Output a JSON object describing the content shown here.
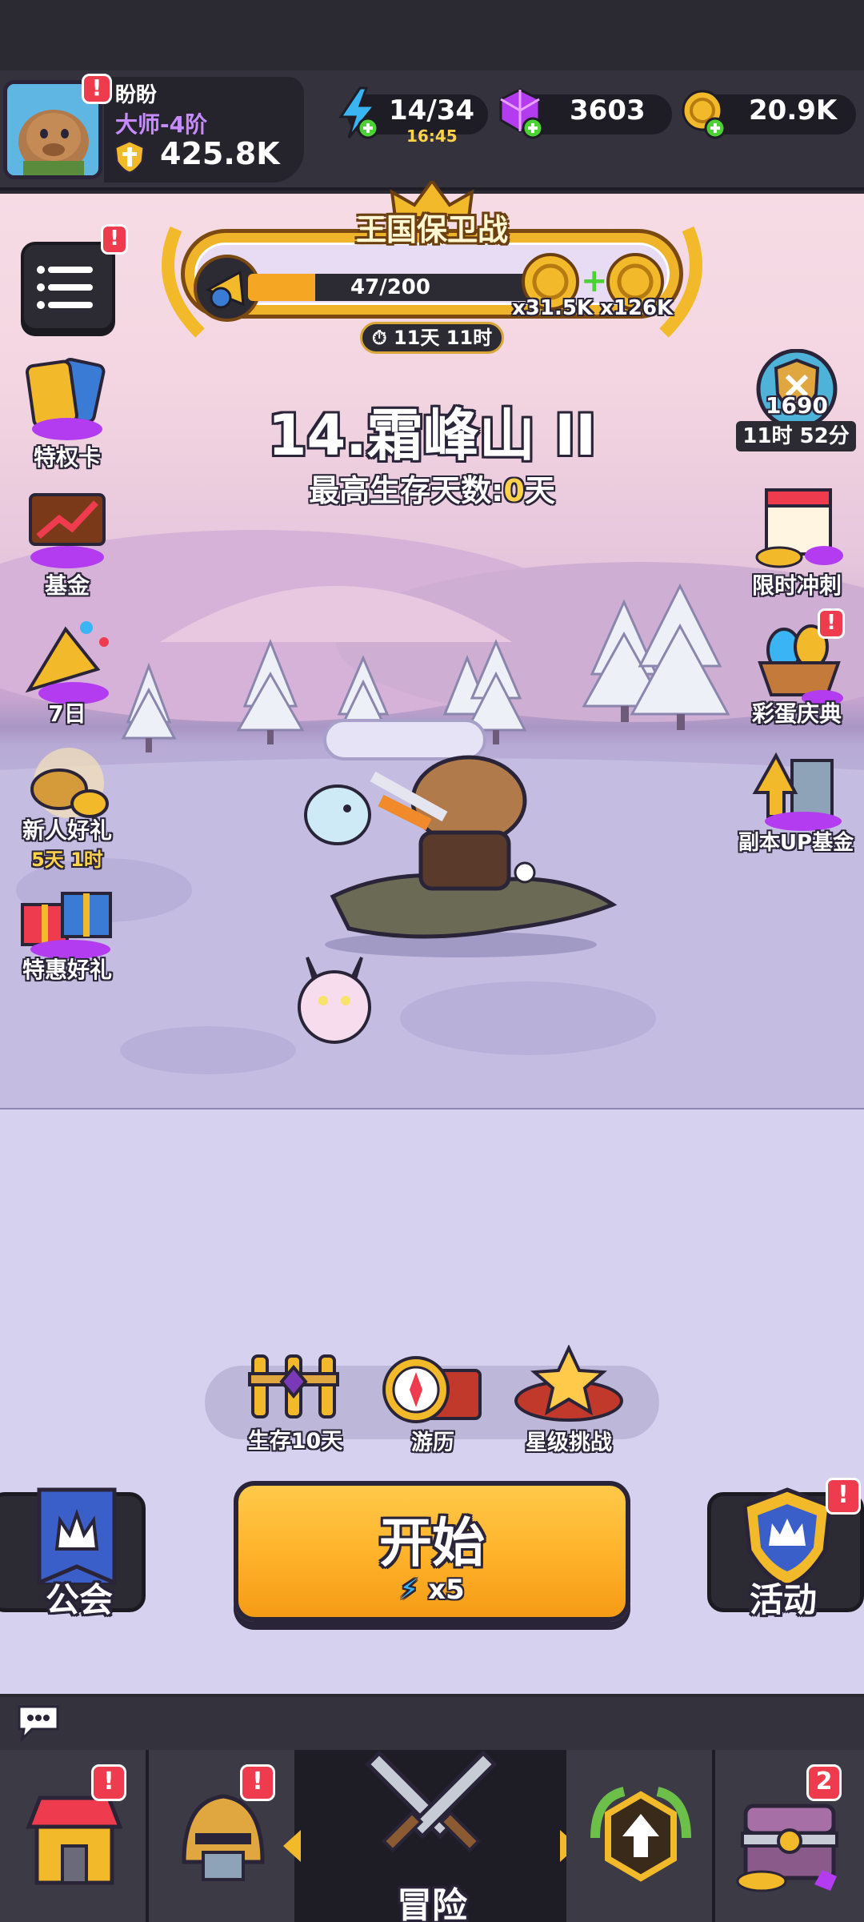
{
  "player": {
    "name": "盼盼",
    "rank": "大师-4阶",
    "power": "425.8K"
  },
  "resources": {
    "energy": "14/34",
    "energy_timer": "16:45",
    "gems": "3603",
    "gold": "20.9K"
  },
  "event": {
    "title": "王国保卫战",
    "progress_text": "47/200",
    "progress_fraction": 0.235,
    "reward1": "x31.5K",
    "reward2": "x126K",
    "timer": "11天 11时"
  },
  "stage": {
    "title": "14.霜峰山 II",
    "best_survival_prefix": "最高生存天数:",
    "best_survival_value": "0",
    "best_survival_suffix": "天"
  },
  "left_menu": [
    {
      "label": "特权卡"
    },
    {
      "label": "基金"
    },
    {
      "label": "7日"
    },
    {
      "label": "新人好礼",
      "timer": "5天 1时"
    },
    {
      "label": "特惠好礼"
    }
  ],
  "right_menu": {
    "rank_score": "1690",
    "rank_timer": "11时 52分",
    "items": [
      {
        "label": "限时冲刺"
      },
      {
        "label": "彩蛋庆典"
      },
      {
        "label": "副本UP基金"
      }
    ]
  },
  "features": [
    {
      "label": "生存10天"
    },
    {
      "label": "游历"
    },
    {
      "label": "星级挑战"
    }
  ],
  "start_button": {
    "label": "开始",
    "cost": "x5"
  },
  "guild_button": {
    "label": "公会"
  },
  "activity_button": {
    "label": "活动"
  },
  "bottom_nav": {
    "adventure_label": "冒险",
    "chest_badge": "2"
  },
  "alerts": {
    "mark": "!"
  },
  "colors": {
    "accent_orange": "#f5a623",
    "alert_red": "#ef3b4e",
    "gem_purple": "#b43cf0",
    "gold": "#f2b92a"
  }
}
